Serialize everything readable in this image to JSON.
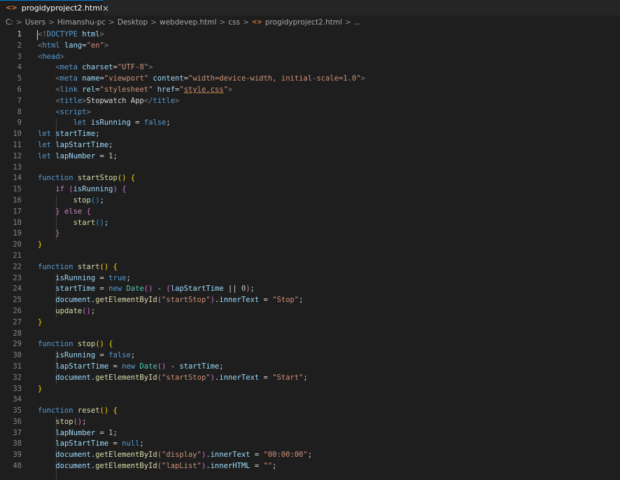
{
  "tab": {
    "label": "progidyproject2.html",
    "icon": "html-file-icon",
    "close_icon": "×"
  },
  "breadcrumb": {
    "items": [
      "C:",
      "Users",
      "Himanshu-pc",
      "Desktop",
      "webdevep.html",
      "css"
    ],
    "file": "progidyproject2.html",
    "trailing": "..."
  },
  "colors": {
    "background": "#1e1e1e",
    "tab_background": "#252526",
    "accent": "#0078d4",
    "html_icon": "#e37933"
  },
  "lines": [
    {
      "n": "1",
      "tokens": [
        [
          "tag",
          "<!"
        ],
        [
          "tname",
          "DOCTYPE"
        ],
        [
          "plain",
          " "
        ],
        [
          "attr",
          "html"
        ],
        [
          "tag",
          ">"
        ]
      ]
    },
    {
      "n": "2",
      "tokens": [
        [
          "tag",
          "<"
        ],
        [
          "tname",
          "html"
        ],
        [
          "plain",
          " "
        ],
        [
          "attr",
          "lang"
        ],
        [
          "plain",
          "="
        ],
        [
          "str",
          "\"en\""
        ],
        [
          "tag",
          ">"
        ]
      ]
    },
    {
      "n": "3",
      "tokens": [
        [
          "tag",
          "<"
        ],
        [
          "tname",
          "head"
        ],
        [
          "tag",
          ">"
        ]
      ]
    },
    {
      "n": "4",
      "tokens": [
        [
          "plain",
          "    "
        ],
        [
          "tag",
          "<"
        ],
        [
          "tname",
          "meta"
        ],
        [
          "plain",
          " "
        ],
        [
          "attr",
          "charset"
        ],
        [
          "plain",
          "="
        ],
        [
          "str",
          "\"UTF-8\""
        ],
        [
          "tag",
          ">"
        ]
      ]
    },
    {
      "n": "5",
      "tokens": [
        [
          "plain",
          "    "
        ],
        [
          "tag",
          "<"
        ],
        [
          "tname",
          "meta"
        ],
        [
          "plain",
          " "
        ],
        [
          "attr",
          "name"
        ],
        [
          "plain",
          "="
        ],
        [
          "str",
          "\"viewport\""
        ],
        [
          "plain",
          " "
        ],
        [
          "attr",
          "content"
        ],
        [
          "plain",
          "="
        ],
        [
          "str",
          "\"width=device-width, initial-scale=1.0\""
        ],
        [
          "tag",
          ">"
        ]
      ]
    },
    {
      "n": "6",
      "tokens": [
        [
          "plain",
          "    "
        ],
        [
          "tag",
          "<"
        ],
        [
          "tname",
          "link"
        ],
        [
          "plain",
          " "
        ],
        [
          "attr",
          "rel"
        ],
        [
          "plain",
          "="
        ],
        [
          "str",
          "\"stylesheet\""
        ],
        [
          "plain",
          " "
        ],
        [
          "attr",
          "href"
        ],
        [
          "plain",
          "="
        ],
        [
          "str",
          "\""
        ],
        [
          "str ul",
          "style.css"
        ],
        [
          "str",
          "\""
        ],
        [
          "tag",
          ">"
        ]
      ]
    },
    {
      "n": "7",
      "tokens": [
        [
          "plain",
          "    "
        ],
        [
          "tag",
          "<"
        ],
        [
          "tname",
          "title"
        ],
        [
          "tag",
          ">"
        ],
        [
          "plain",
          "Stopwatch App"
        ],
        [
          "tag",
          "</"
        ],
        [
          "tname",
          "title"
        ],
        [
          "tag",
          ">"
        ]
      ]
    },
    {
      "n": "8",
      "tokens": [
        [
          "plain",
          "    "
        ],
        [
          "tag",
          "<"
        ],
        [
          "tname",
          "script"
        ],
        [
          "tag",
          ">"
        ]
      ]
    },
    {
      "n": "9",
      "tokens": [
        [
          "plain",
          "        "
        ],
        [
          "kw",
          "let"
        ],
        [
          "plain",
          " "
        ],
        [
          "var",
          "isRunning"
        ],
        [
          "plain",
          " = "
        ],
        [
          "kw",
          "false"
        ],
        [
          "plain",
          ";"
        ]
      ]
    },
    {
      "n": "10",
      "tokens": [
        [
          "kw",
          "let"
        ],
        [
          "plain",
          " "
        ],
        [
          "var",
          "startTime"
        ],
        [
          "plain",
          ";"
        ]
      ]
    },
    {
      "n": "11",
      "tokens": [
        [
          "kw",
          "let"
        ],
        [
          "plain",
          " "
        ],
        [
          "var",
          "lapStartTime"
        ],
        [
          "plain",
          ";"
        ]
      ]
    },
    {
      "n": "12",
      "tokens": [
        [
          "kw",
          "let"
        ],
        [
          "plain",
          " "
        ],
        [
          "var",
          "lapNumber"
        ],
        [
          "plain",
          " = "
        ],
        [
          "num",
          "1"
        ],
        [
          "plain",
          ";"
        ]
      ]
    },
    {
      "n": "13",
      "tokens": []
    },
    {
      "n": "14",
      "tokens": [
        [
          "kw",
          "function"
        ],
        [
          "plain",
          " "
        ],
        [
          "fn",
          "startStop"
        ],
        [
          "p1",
          "()"
        ],
        [
          "plain",
          " "
        ],
        [
          "p1",
          "{"
        ]
      ]
    },
    {
      "n": "15",
      "tokens": [
        [
          "plain",
          "    "
        ],
        [
          "ctl",
          "if"
        ],
        [
          "plain",
          " "
        ],
        [
          "p2",
          "("
        ],
        [
          "var",
          "isRunning"
        ],
        [
          "p2",
          ")"
        ],
        [
          "plain",
          " "
        ],
        [
          "p2",
          "{"
        ]
      ]
    },
    {
      "n": "16",
      "tokens": [
        [
          "plain",
          "        "
        ],
        [
          "fn",
          "stop"
        ],
        [
          "p3",
          "()"
        ],
        [
          "plain",
          ";"
        ]
      ]
    },
    {
      "n": "17",
      "tokens": [
        [
          "plain",
          "    "
        ],
        [
          "p2",
          "}"
        ],
        [
          "plain",
          " "
        ],
        [
          "ctl",
          "else"
        ],
        [
          "plain",
          " "
        ],
        [
          "p2",
          "{"
        ]
      ]
    },
    {
      "n": "18",
      "tokens": [
        [
          "plain",
          "        "
        ],
        [
          "fn",
          "start"
        ],
        [
          "p3",
          "()"
        ],
        [
          "plain",
          ";"
        ]
      ]
    },
    {
      "n": "19",
      "tokens": [
        [
          "plain",
          "    "
        ],
        [
          "p2",
          "}"
        ]
      ]
    },
    {
      "n": "20",
      "tokens": [
        [
          "p1",
          "}"
        ]
      ]
    },
    {
      "n": "21",
      "tokens": []
    },
    {
      "n": "22",
      "tokens": [
        [
          "kw",
          "function"
        ],
        [
          "plain",
          " "
        ],
        [
          "fn",
          "start"
        ],
        [
          "p1",
          "()"
        ],
        [
          "plain",
          " "
        ],
        [
          "p1",
          "{"
        ]
      ]
    },
    {
      "n": "23",
      "tokens": [
        [
          "plain",
          "    "
        ],
        [
          "var",
          "isRunning"
        ],
        [
          "plain",
          " = "
        ],
        [
          "kw",
          "true"
        ],
        [
          "plain",
          ";"
        ]
      ]
    },
    {
      "n": "24",
      "tokens": [
        [
          "plain",
          "    "
        ],
        [
          "var",
          "startTime"
        ],
        [
          "plain",
          " = "
        ],
        [
          "kw",
          "new"
        ],
        [
          "plain",
          " "
        ],
        [
          "cls",
          "Date"
        ],
        [
          "p2",
          "()"
        ],
        [
          "plain",
          " - "
        ],
        [
          "p2",
          "("
        ],
        [
          "var",
          "lapStartTime"
        ],
        [
          "plain",
          " || "
        ],
        [
          "num",
          "0"
        ],
        [
          "p2",
          ")"
        ],
        [
          "plain",
          ";"
        ]
      ]
    },
    {
      "n": "25",
      "tokens": [
        [
          "plain",
          "    "
        ],
        [
          "var",
          "document"
        ],
        [
          "plain",
          "."
        ],
        [
          "fn",
          "getElementById"
        ],
        [
          "p2",
          "("
        ],
        [
          "str",
          "\"startStop\""
        ],
        [
          "p2",
          ")"
        ],
        [
          "plain",
          "."
        ],
        [
          "var",
          "innerText"
        ],
        [
          "plain",
          " = "
        ],
        [
          "str",
          "\"Stop\""
        ],
        [
          "plain",
          ";"
        ]
      ]
    },
    {
      "n": "26",
      "tokens": [
        [
          "plain",
          "    "
        ],
        [
          "fn",
          "update"
        ],
        [
          "p2",
          "()"
        ],
        [
          "plain",
          ";"
        ]
      ]
    },
    {
      "n": "27",
      "tokens": [
        [
          "p1",
          "}"
        ]
      ]
    },
    {
      "n": "28",
      "tokens": []
    },
    {
      "n": "29",
      "tokens": [
        [
          "kw",
          "function"
        ],
        [
          "plain",
          " "
        ],
        [
          "fn",
          "stop"
        ],
        [
          "p1",
          "()"
        ],
        [
          "plain",
          " "
        ],
        [
          "p1",
          "{"
        ]
      ]
    },
    {
      "n": "30",
      "tokens": [
        [
          "plain",
          "    "
        ],
        [
          "var",
          "isRunning"
        ],
        [
          "plain",
          " = "
        ],
        [
          "kw",
          "false"
        ],
        [
          "plain",
          ";"
        ]
      ]
    },
    {
      "n": "31",
      "tokens": [
        [
          "plain",
          "    "
        ],
        [
          "var",
          "lapStartTime"
        ],
        [
          "plain",
          " = "
        ],
        [
          "kw",
          "new"
        ],
        [
          "plain",
          " "
        ],
        [
          "cls",
          "Date"
        ],
        [
          "p2",
          "()"
        ],
        [
          "plain",
          " - "
        ],
        [
          "var",
          "startTime"
        ],
        [
          "plain",
          ";"
        ]
      ]
    },
    {
      "n": "32",
      "tokens": [
        [
          "plain",
          "    "
        ],
        [
          "var",
          "document"
        ],
        [
          "plain",
          "."
        ],
        [
          "fn",
          "getElementById"
        ],
        [
          "p2",
          "("
        ],
        [
          "str",
          "\"startStop\""
        ],
        [
          "p2",
          ")"
        ],
        [
          "plain",
          "."
        ],
        [
          "var",
          "innerText"
        ],
        [
          "plain",
          " = "
        ],
        [
          "str",
          "\"Start\""
        ],
        [
          "plain",
          ";"
        ]
      ]
    },
    {
      "n": "33",
      "tokens": [
        [
          "p1",
          "}"
        ]
      ]
    },
    {
      "n": "34",
      "tokens": []
    },
    {
      "n": "35",
      "tokens": [
        [
          "kw",
          "function"
        ],
        [
          "plain",
          " "
        ],
        [
          "fn",
          "reset"
        ],
        [
          "p1",
          "()"
        ],
        [
          "plain",
          " "
        ],
        [
          "p1",
          "{"
        ]
      ]
    },
    {
      "n": "36",
      "tokens": [
        [
          "plain",
          "    "
        ],
        [
          "fn",
          "stop"
        ],
        [
          "p2",
          "()"
        ],
        [
          "plain",
          ";"
        ]
      ]
    },
    {
      "n": "37",
      "tokens": [
        [
          "plain",
          "    "
        ],
        [
          "var",
          "lapNumber"
        ],
        [
          "plain",
          " = "
        ],
        [
          "num",
          "1"
        ],
        [
          "plain",
          ";"
        ]
      ]
    },
    {
      "n": "38",
      "tokens": [
        [
          "plain",
          "    "
        ],
        [
          "var",
          "lapStartTime"
        ],
        [
          "plain",
          " = "
        ],
        [
          "kw",
          "null"
        ],
        [
          "plain",
          ";"
        ]
      ]
    },
    {
      "n": "39",
      "tokens": [
        [
          "plain",
          "    "
        ],
        [
          "var",
          "document"
        ],
        [
          "plain",
          "."
        ],
        [
          "fn",
          "getElementById"
        ],
        [
          "p2",
          "("
        ],
        [
          "str",
          "\"display\""
        ],
        [
          "p2",
          ")"
        ],
        [
          "plain",
          "."
        ],
        [
          "var",
          "innerText"
        ],
        [
          "plain",
          " = "
        ],
        [
          "str",
          "\"00:00:00\""
        ],
        [
          "plain",
          ";"
        ]
      ]
    },
    {
      "n": "40",
      "tokens": [
        [
          "plain",
          "    "
        ],
        [
          "var",
          "document"
        ],
        [
          "plain",
          "."
        ],
        [
          "fn",
          "getElementById"
        ],
        [
          "p2",
          "("
        ],
        [
          "str",
          "\"lapList\""
        ],
        [
          "p2",
          ")"
        ],
        [
          "plain",
          "."
        ],
        [
          "var",
          "innerHTML"
        ],
        [
          "plain",
          " = "
        ],
        [
          "str",
          "\"\""
        ],
        [
          "plain",
          ";"
        ]
      ]
    }
  ]
}
